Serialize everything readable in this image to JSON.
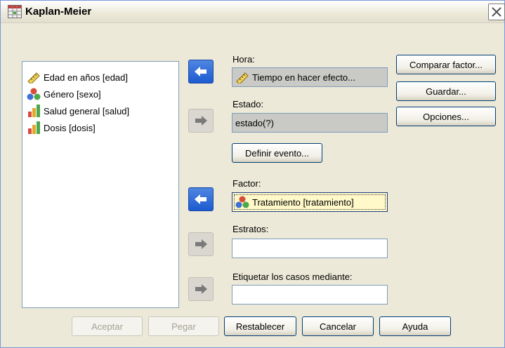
{
  "window": {
    "title": "Kaplan-Meier"
  },
  "variables": [
    {
      "label": "Edad en años [edad]",
      "icon": "ruler-scale-icon"
    },
    {
      "label": "Género [sexo]",
      "icon": "nominal-circles-icon"
    },
    {
      "label": "Salud general [salud]",
      "icon": "ordinal-bars-icon"
    },
    {
      "label": "Dosis [dosis]",
      "icon": "ordinal-bars-icon"
    }
  ],
  "fields": {
    "hora": {
      "label": "Hora:",
      "value": "Tiempo en hacer efecto..."
    },
    "estado": {
      "label": "Estado:",
      "value": "estado(?)"
    },
    "factor": {
      "label": "Factor:",
      "value": "Tratamiento [tratamiento]"
    },
    "estratos": {
      "label": "Estratos:",
      "value": ""
    },
    "etiquetar": {
      "label": "Etiquetar los casos mediante:",
      "value": ""
    }
  },
  "buttons": {
    "definir_evento": "Definir evento...",
    "comparar_factor": "Comparar factor...",
    "guardar": "Guardar...",
    "opciones": "Opciones...",
    "aceptar": "Aceptar",
    "pegar": "Pegar",
    "restablecer": "Restablecer",
    "cancelar": "Cancelar",
    "ayuda": "Ayuda"
  },
  "colors": {
    "arrow_active": "#1c5bd0",
    "arrow_inactive": "#d9d7cf",
    "focus_field": "#fff8c8"
  }
}
